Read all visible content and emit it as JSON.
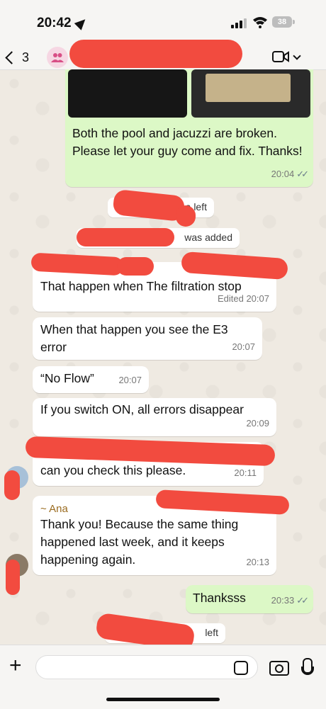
{
  "status_bar": {
    "time": "20:42",
    "battery": "38"
  },
  "header": {
    "back_count": "3",
    "group_icon": "group-icon",
    "video_icon": "video-call-icon"
  },
  "messages": {
    "m1": {
      "text": "Both the pool and jacuzzi are broken. Please let your guy come and fix. Thanks!",
      "time": "20:04"
    },
    "sys1": {
      "text": "a left"
    },
    "sys2": {
      "text": "was added"
    },
    "m2": {
      "text": "That happen when The filtration stop",
      "time": "Edited 20:07"
    },
    "m3": {
      "text": "When that happen you see the E3 error",
      "time": "20:07"
    },
    "m4": {
      "text": "“No Flow”",
      "time": "20:07"
    },
    "m5": {
      "text": "If you switch ON, all errors disappear",
      "time": "20:09"
    },
    "m6": {
      "text": "can you check this please.",
      "time": "20:11"
    },
    "m7": {
      "sender": "~ Ana",
      "text": "Thank you! Because the same thing happened last week, and it keeps happening again.",
      "time": "20:13"
    },
    "m8": {
      "text": "Thanksss",
      "time": "20:33"
    },
    "sys3": {
      "text": "left"
    }
  },
  "colors": {
    "redaction": "#f24b3f",
    "outgoing": "#dcf8c6",
    "incoming": "#ffffff"
  }
}
